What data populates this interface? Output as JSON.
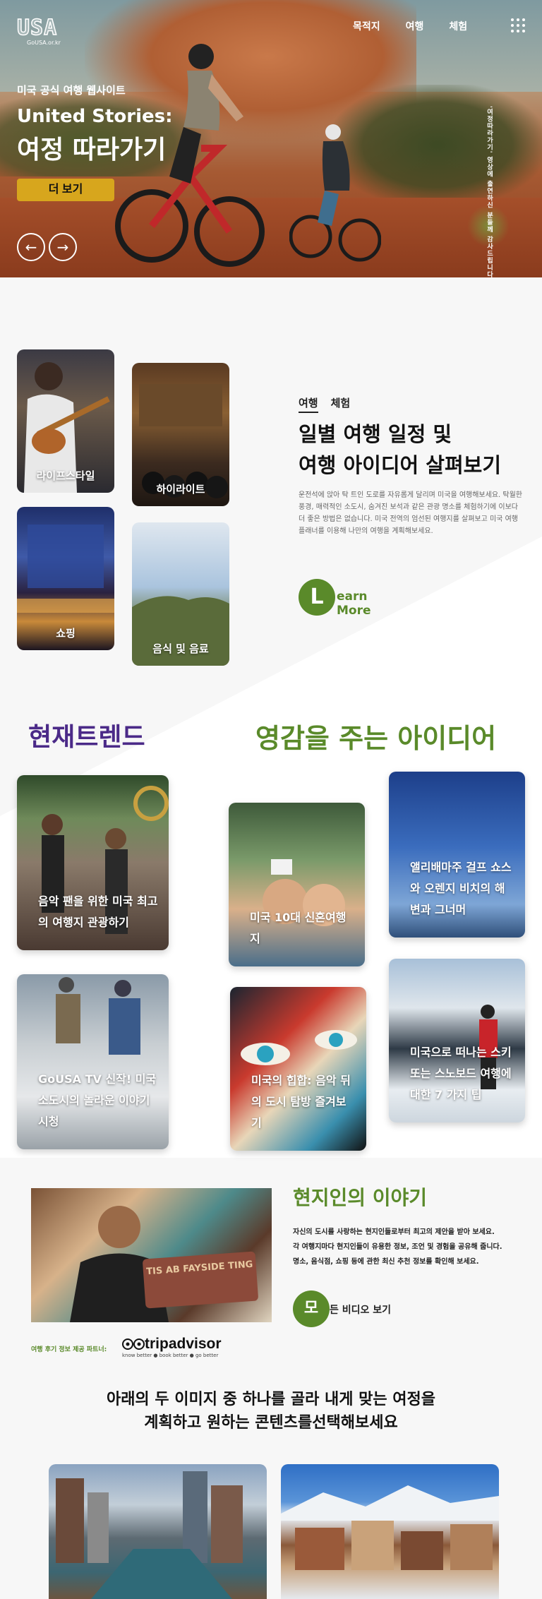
{
  "header": {
    "logo_text": "USA",
    "logo_sub": "GoUSA.or.kr",
    "nav": [
      "목적지",
      "여행",
      "체험"
    ],
    "menu_icon": "grid-dots-icon"
  },
  "hero": {
    "eyebrow": "미국 공식 여행 웹사이트",
    "title_line1": "United Stories:",
    "title_line2": "여정 따라가기",
    "more_label": "더 보기",
    "prev_label": "←",
    "next_label": "→",
    "vertical_text": "'여정따라가기' 영상에 출연하신 분들께 감사드립니다"
  },
  "categories": [
    {
      "label": "라이프스타일"
    },
    {
      "label": "하이라이트"
    },
    {
      "label": "쇼핑"
    },
    {
      "label": "음식 및 음료"
    }
  ],
  "intro": {
    "tabs": [
      "여행",
      "체험"
    ],
    "title_line1": "일별 여행 일정 및",
    "title_line2": "여행 아이디어 살펴보기",
    "description": "운전석에 앉아 탁 트인 도로를 자유롭게 달리며 미국을 여행해보세요. 탁월한 풍경, 매력적인 소도시, 숨겨진 보석과 같은 관광 명소를 체험하기에 이보다 더 좋은 방법은 없습니다. 미국 전역의 엄선된 여행지를 살펴보고 미국 여행 플래너를 이용해 나만의 여행을 계획해보세요.",
    "learn_more_initial": "L",
    "learn_more_rest": "earn More"
  },
  "trends": {
    "title": "현재트렌드",
    "ideas_title": "영감을 주는 아이디어",
    "cards": [
      {
        "label": "음악 팬을 위한 미국 최고의 여행지 관광하기"
      },
      {
        "label": "GoUSA TV 신작! 미국 소도시의 놀라운 이야기 시청"
      },
      {
        "label": "미국 10대 신혼여행지"
      },
      {
        "label": "미국의 힙합: 음악 뒤의 도시 탐방 즐겨보기"
      },
      {
        "label": "앨리배마주 걸프 쇼스와 오렌지 비치의 해변과 그너머"
      },
      {
        "label": "미국으로 떠나는 스키 또는 스노보드 여행에 대한 7 가지 팁"
      }
    ]
  },
  "locals": {
    "title": "현지인의 이야기",
    "desc_line1": "자신의 도시를 사랑하는 현지인들로부터 최고의 제안을 받아 보세요.",
    "desc_line2": "각 여행지마다 현지인들이 유용한 정보, 조언 및 경험을 공유해 줍니다.",
    "desc_line3": "명소, 음식점, 쇼핑 등에 관한 최신 추천 정보를 확인해 보세요.",
    "sign_text": "TIS AB FAYSIDE TING",
    "video_initial": "모",
    "video_rest": "든 비디오 보기",
    "partner_label": "여행 후기 정보 제공 파트너:",
    "partner_brand": "tripadvisor",
    "partner_tagline": "know better ● book better ● go better"
  },
  "choose": {
    "title_line1": "아래의 두 이미지 중 하나를 골라 내게 맞는 여정을",
    "title_line2": "계획하고 원하는 콘텐츠를선택해보세요"
  },
  "colors": {
    "accent_green": "#5a8a2a",
    "accent_purple": "#4b2a88",
    "button_gold": "#d7a61d"
  }
}
